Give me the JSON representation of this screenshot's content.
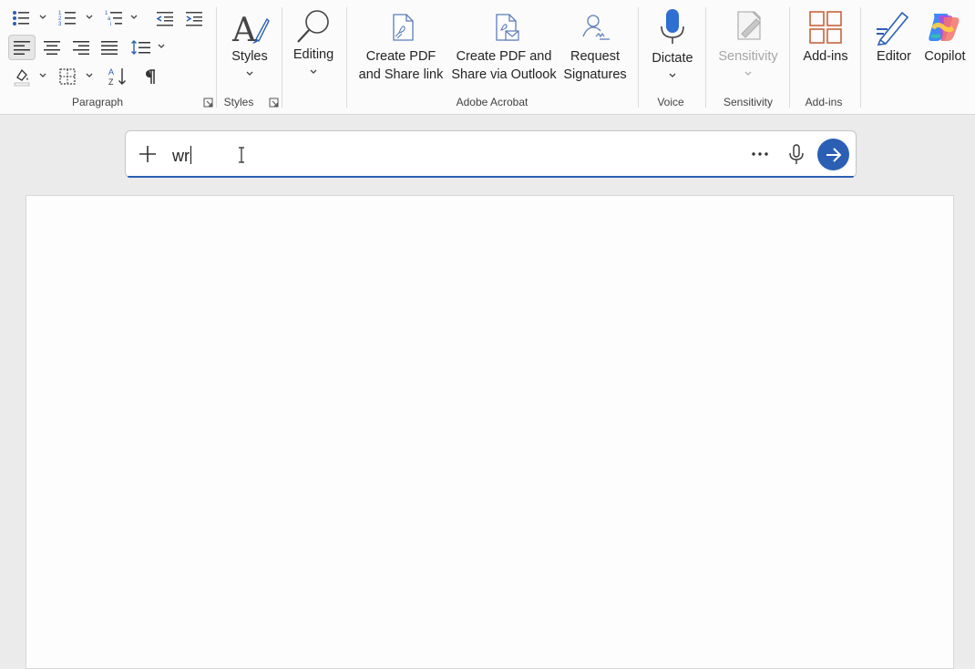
{
  "ribbon": {
    "groups": {
      "paragraph": "Paragraph",
      "styles": "Styles",
      "adobe_acrobat": "Adobe Acrobat",
      "voice": "Voice",
      "sensitivity": "Sensitivity",
      "addins": "Add-ins"
    },
    "buttons": {
      "styles": "Styles",
      "editing": "Editing",
      "create_pdf_share_link_line1": "Create PDF",
      "create_pdf_share_link_line2": "and Share link",
      "create_pdf_outlook_line1": "Create PDF and",
      "create_pdf_outlook_line2": "Share via Outlook",
      "request_signatures_line1": "Request",
      "request_signatures_line2": "Signatures",
      "dictate": "Dictate",
      "sensitivity": "Sensitivity",
      "addins": "Add-ins",
      "editor": "Editor",
      "copilot": "Copilot"
    },
    "icons": {
      "bullets": "bullets-icon",
      "numbering": "numbering-icon",
      "multilevel": "multilevel-list-icon",
      "decrease_indent": "decrease-indent-icon",
      "increase_indent": "increase-indent-icon",
      "align_left": "align-left-icon",
      "center": "align-center-icon",
      "align_right": "align-right-icon",
      "justify": "justify-icon",
      "line_spacing": "line-spacing-icon",
      "shading": "shading-icon",
      "borders": "borders-icon",
      "sort": "sort-icon",
      "pilcrow": "show-formatting-icon"
    }
  },
  "prompt": {
    "value": "wr",
    "add_icon": "plus-icon",
    "more_icon": "more-options-icon",
    "mic_icon": "microphone-icon",
    "send_icon": "send-arrow-icon"
  },
  "colors": {
    "accent": "#2b5fb3",
    "ribbon_bg": "#fbfbfb",
    "doc_bg": "#ebebeb",
    "page_bg": "#fdfdfd",
    "addins_orange": "#c8643c"
  }
}
